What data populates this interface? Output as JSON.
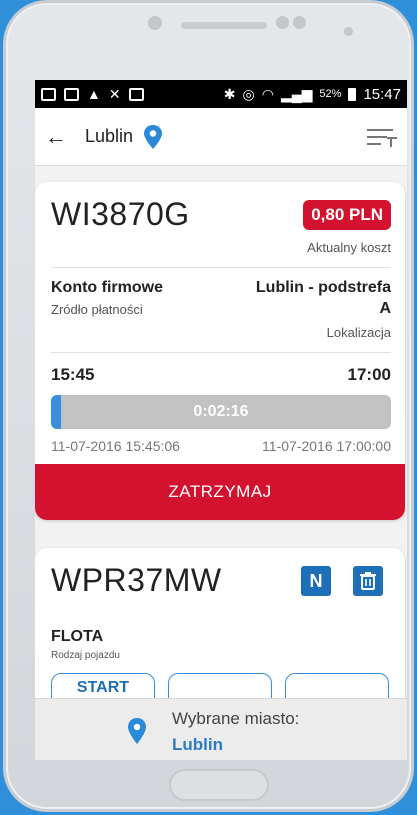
{
  "statusbar": {
    "left_icons": [
      "image-icon",
      "photo-icon",
      "warning-icon",
      "missed-call-icon",
      "mail-icon"
    ],
    "battery_pct": "52%",
    "time": "15:47"
  },
  "toolbar": {
    "back_icon": "arrow-left-icon",
    "title": "Lublin",
    "menu_icon": "playlist-add-icon"
  },
  "active_parking": {
    "plate": "WI3870G",
    "cost": "0,80 PLN",
    "cost_label": "Aktualny koszt",
    "payment_source": "Konto firmowe",
    "payment_source_label": "Zródło płatności",
    "location_line1": "Lublin - podstrefa",
    "location_line2": "A",
    "location_label": "Lokalizacja",
    "start_time": "15:45",
    "end_time": "17:00",
    "elapsed": "0:02:16",
    "progress_fraction": 0.03,
    "start_datetime": "11-07-2016 15:45:06",
    "end_datetime": "11-07-2016 17:00:00",
    "stop_label": "ZATRZYMAJ"
  },
  "vehicle": {
    "plate": "WPR37MW",
    "badge": "N",
    "type": "FLOTA",
    "type_label": "Rodzaj pojazdu",
    "start_label": "START"
  },
  "bottom": {
    "label": "Wybrane miasto:",
    "city": "Lublin"
  },
  "colors": {
    "accent_red": "#d2122e",
    "accent_blue": "#1d6fb8",
    "link_blue": "#2b7cc8"
  }
}
